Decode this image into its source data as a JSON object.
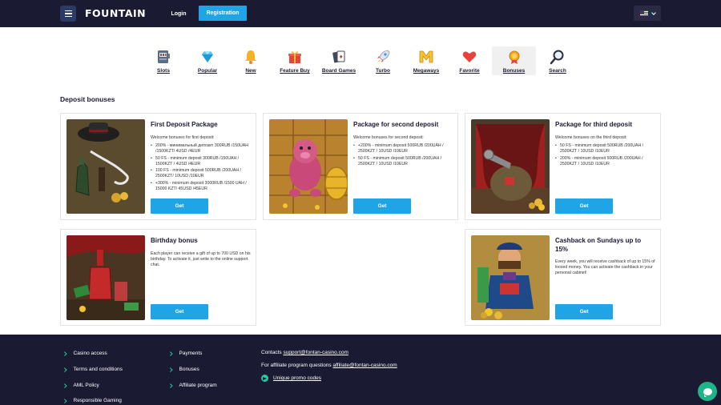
{
  "header": {
    "logo": "FOUNTAIN",
    "login_label": "Login",
    "registration_label": "Registration",
    "menu_icon": "hamburger-icon",
    "language_flag": "us-flag-icon",
    "accent_color": "#1fa5e5",
    "background_color": "#1b1a33"
  },
  "categories": [
    {
      "label": "Slots",
      "icon": "slot-machine-icon"
    },
    {
      "label": "Popular",
      "icon": "diamond-icon"
    },
    {
      "label": "New",
      "icon": "bell-icon"
    },
    {
      "label": "Feature Buy",
      "icon": "gift-icon"
    },
    {
      "label": "Board Games",
      "icon": "cards-icon"
    },
    {
      "label": "Turbo",
      "icon": "rocket-icon"
    },
    {
      "label": "Megaways",
      "icon": "m-icon"
    },
    {
      "label": "Favorite",
      "icon": "heart-icon"
    },
    {
      "label": "Bonuses",
      "icon": "medal-icon",
      "active": true
    },
    {
      "label": "Search",
      "icon": "search-icon"
    }
  ],
  "section_title": "Deposit bonuses",
  "cards": {
    "first": {
      "title": "First Deposit Package",
      "subtitle": "Welcome bonuses for first deposit:",
      "items": [
        "200% - минимальный депозит 300RUB /150UAH /1500KZT/ 4USD /4EUR",
        "50 FS - minimum deposit 300RUB /150UAH / 1500KZT / 4USD /4EUR",
        "100 FS - minimum deposit 500RUB /200UAH / 2500KZT/ 10USD /10EUR",
        "+300% - minimum deposit 3000RUB /1500 UAH / 15000 KZT/ 45USD /45EUR"
      ],
      "button": "Get"
    },
    "second": {
      "title": "Package for second deposit",
      "subtitle": "Welcome bonuses for second deposit:",
      "items": [
        "+200% - minimum deposit 500RUB /200UAH / 2500KZT / 10USD /10EUR",
        "50 FS - minimum deposit 500RUB /200UAH / 2500KZT / 10USD /10EUR"
      ],
      "button": "Get"
    },
    "third": {
      "title": "Package for third deposit",
      "subtitle": "Welcome bonuses on the third deposit:",
      "items": [
        "50 FS - minimum deposit 500RUB /200UAH / 2500KZT / 10USD /10EUR",
        "200% - minimum deposit 500RUB /200UAH / 2500KZT / 10USD /10EUR"
      ],
      "button": "Get"
    },
    "birthday": {
      "title": "Birthday bonus",
      "body": "Each player can receive a gift of up to 700 USD on his birthday. To activate it, just write to the online support chat.",
      "button": "Get"
    },
    "cashback": {
      "title": "Cashback on Sundays up to 15%",
      "body": "Every week, you will receive cashback of up to 15% of loosed money. You can activate the cashback in your personal cabinet!",
      "button": "Get"
    }
  },
  "footer": {
    "col1": [
      "Casino access",
      "Terms and conditions",
      "AML Policy",
      "Responsible Gaming"
    ],
    "col2": [
      "Payments",
      "Bonuses",
      "Affiliate program"
    ],
    "contacts_label": "Contacts",
    "contacts_email": "support@fontan-casino.com",
    "affiliate_label": "For affiliate program questions",
    "affiliate_email": "affiliate@fontan-casino.com",
    "promo_label": "Unique promo codes",
    "chat_icon": "chat-icon"
  }
}
